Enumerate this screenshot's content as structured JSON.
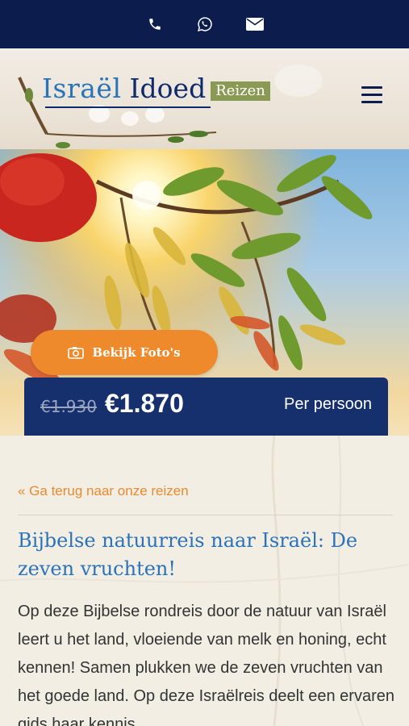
{
  "topbar": {
    "icons": [
      "phone-icon",
      "whatsapp-icon",
      "envelope-icon"
    ],
    "background": "#0b1c4d"
  },
  "logo": {
    "word1": "Israël",
    "word2": "Idoed",
    "badge": "Reizen"
  },
  "hero": {
    "photo_button": "Bekijk Foto's"
  },
  "price": {
    "old": "€1.930",
    "new": "€1.870",
    "per": "Per persoon"
  },
  "content": {
    "back_link": "« Ga terug naar onze reizen",
    "title": "Bijbelse natuurreis naar Israël: De zeven vruchten!",
    "body": "Op deze Bijbelse rondreis door de natuur van Israël leert u het land, vloeiende van melk en honing, echt kennen! Samen plukken we de zeven vruchten van het goede land. Op deze Israëlreis deelt een ervaren gids haar kennis"
  },
  "colors": {
    "accent_orange": "#ee8a2b",
    "navy": "#16306e",
    "blue": "#2a73b8"
  }
}
